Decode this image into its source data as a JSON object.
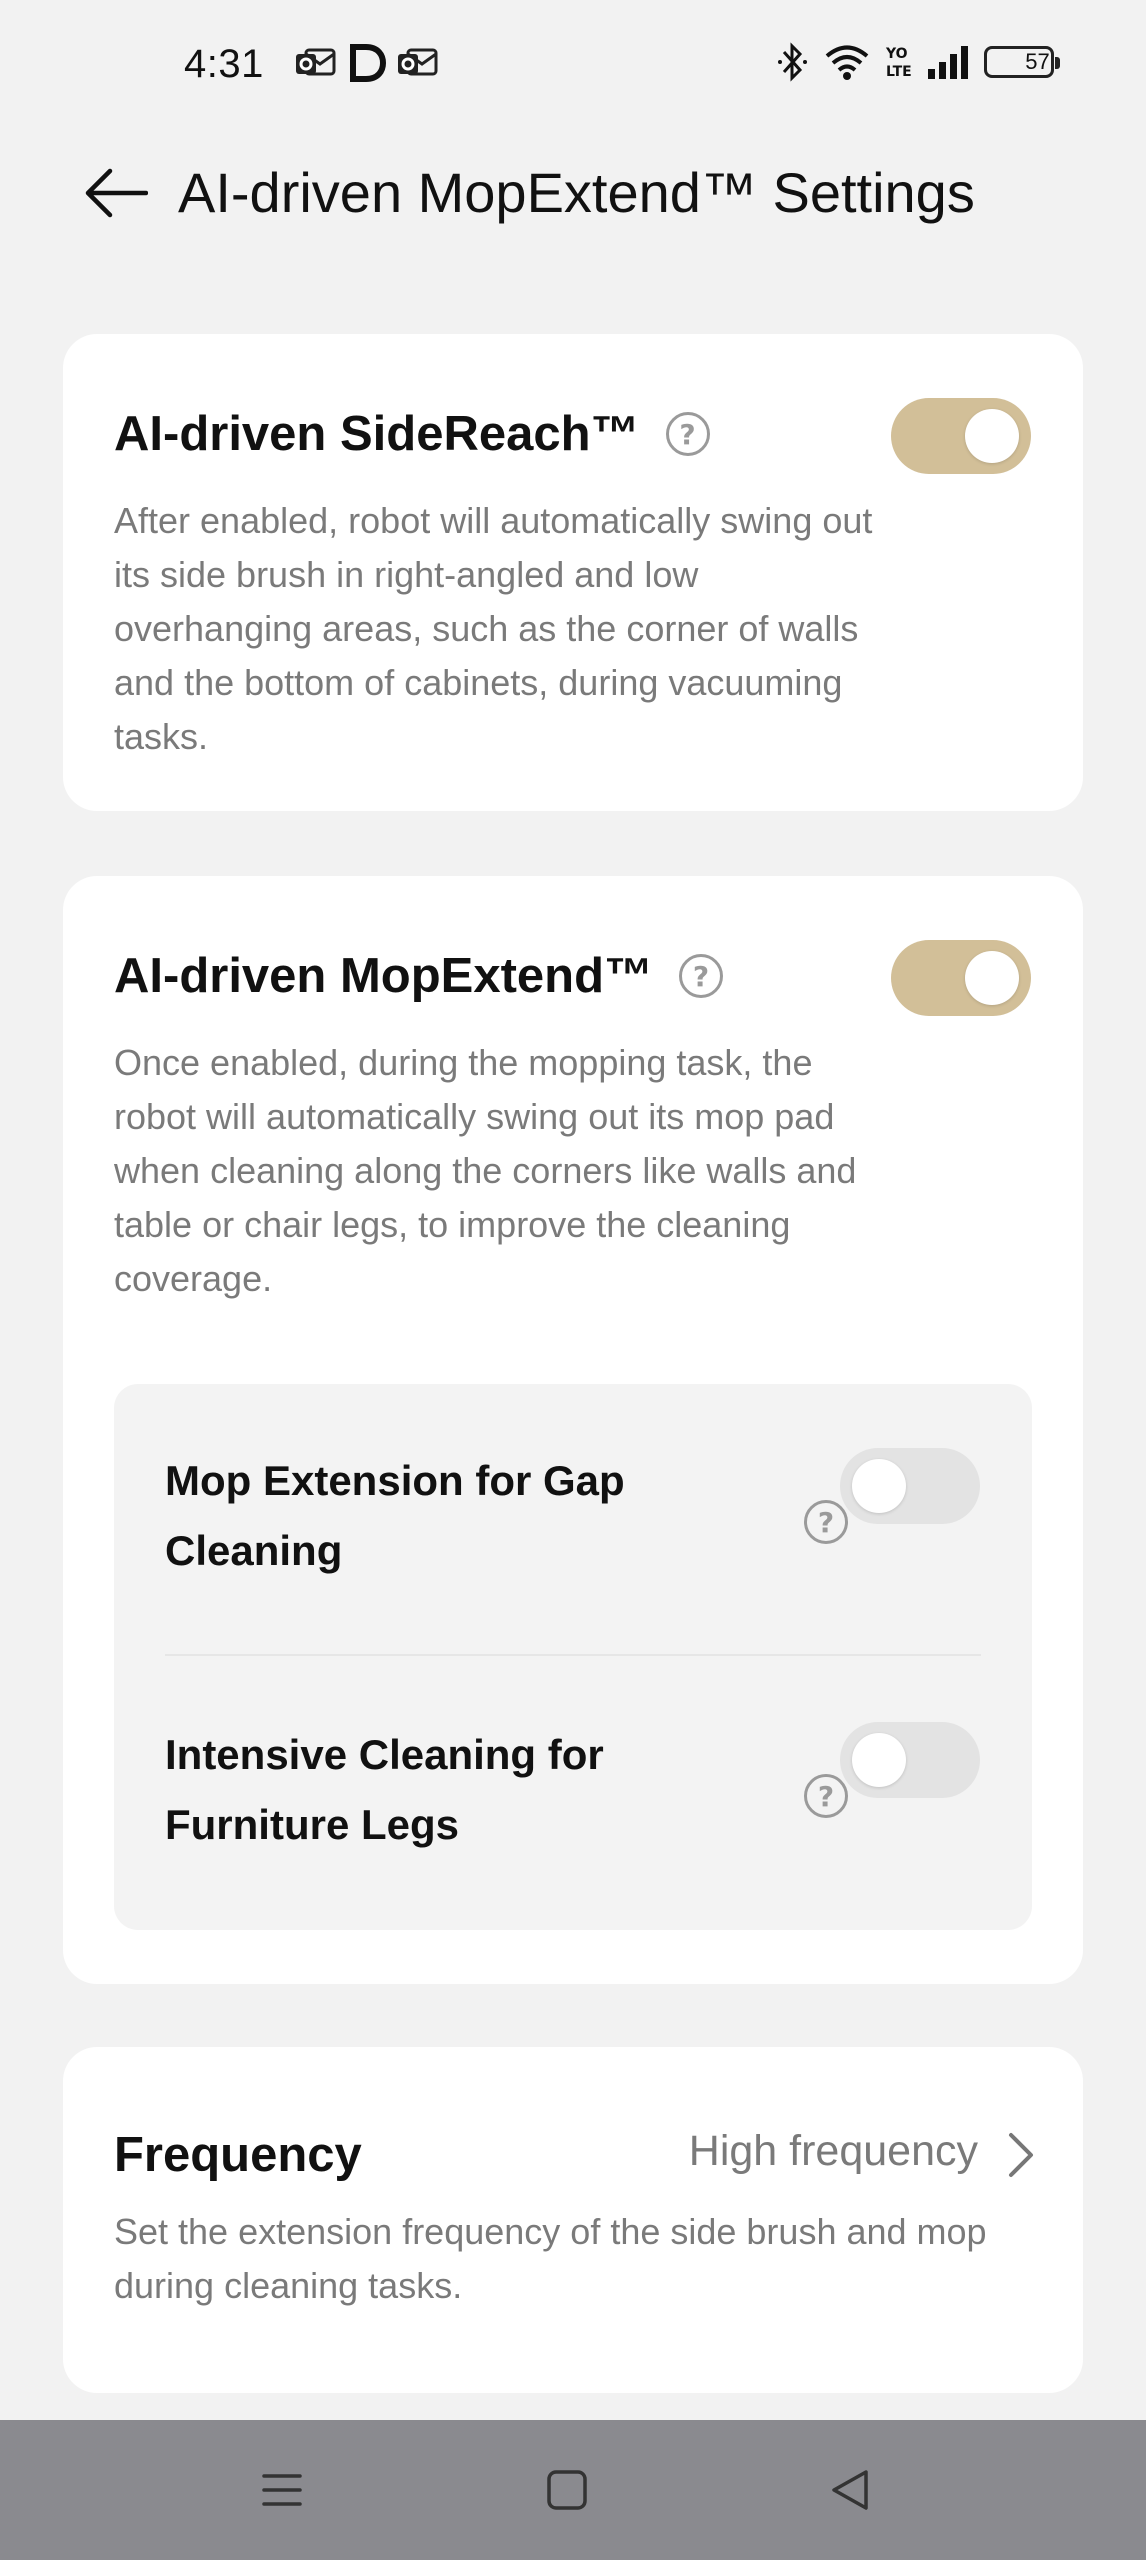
{
  "status_bar": {
    "time": "4:31",
    "battery_level": "57",
    "left_icons": [
      "outlook-icon",
      "d-app-icon",
      "outlook-icon"
    ],
    "right_icons": [
      "bluetooth-icon",
      "wifi-icon",
      "volte-icon",
      "signal-icon",
      "battery-icon"
    ]
  },
  "header": {
    "title": "AI-driven MopExtend™ Settings",
    "back_icon": "arrow-left-icon"
  },
  "sidereach": {
    "title": "AI-driven SideReach™",
    "description": "After enabled, robot will automatically swing out its side brush in right-angled and low overhanging areas, such as the corner of walls and the bottom of cabinets, during vacuuming tasks.",
    "enabled": true
  },
  "mopextend": {
    "title": "AI-driven MopExtend™",
    "description": "Once enabled, during the mopping task, the robot will automatically swing out its mop pad when cleaning along the corners like walls and table or chair legs, to improve the cleaning coverage.",
    "enabled": true,
    "sub_options": [
      {
        "label": "Mop Extension for Gap Cleaning",
        "enabled": false
      },
      {
        "label": "Intensive Cleaning for Furniture Legs",
        "enabled": false
      }
    ]
  },
  "frequency": {
    "title": "Frequency",
    "value": "High frequency",
    "description": "Set the extension frequency of the side brush and mop during cleaning tasks."
  },
  "help_glyph": "?",
  "colors": {
    "toggle_on": "#d2bf98",
    "toggle_off": "#e3e3e3",
    "background": "#f2f2f2",
    "nav_bar": "#8a8a8f"
  },
  "nav_bar": {
    "buttons": [
      "menu-icon",
      "home-square-icon",
      "back-triangle-icon"
    ]
  }
}
